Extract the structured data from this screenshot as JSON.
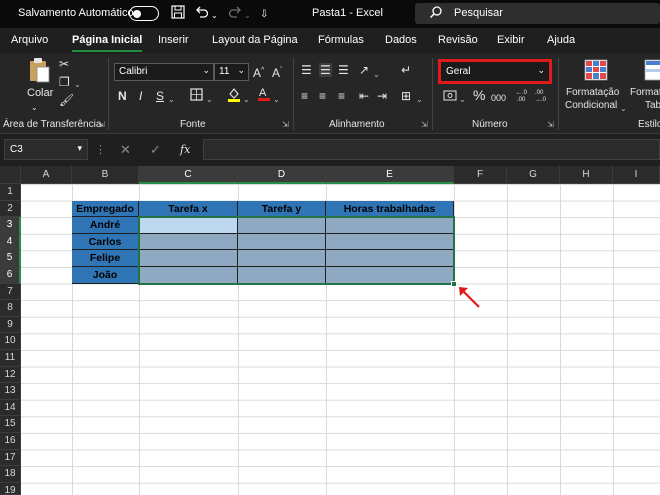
{
  "titlebar": {
    "autosave_label": "Salvamento Automático",
    "doc_title": "Pasta1  -  Excel",
    "search_placeholder": "Pesquisar"
  },
  "tabs": [
    {
      "label": "Arquivo"
    },
    {
      "label": "Página Inicial",
      "active": true
    },
    {
      "label": "Inserir"
    },
    {
      "label": "Layout da Página"
    },
    {
      "label": "Fórmulas"
    },
    {
      "label": "Dados"
    },
    {
      "label": "Revisão"
    },
    {
      "label": "Exibir"
    },
    {
      "label": "Ajuda"
    }
  ],
  "ribbon": {
    "clipboard": {
      "paste_label": "Colar",
      "group_label": "Área de Transferência"
    },
    "font": {
      "family": "Calibri",
      "size": "11",
      "bold": "N",
      "italic": "I",
      "underline": "S",
      "group_label": "Fonte"
    },
    "alignment": {
      "group_label": "Alinhamento"
    },
    "number": {
      "format": "Geral",
      "percent": "%",
      "thousands": "000",
      "group_label": "Número"
    },
    "styles": {
      "cond_format_line1": "Formatação",
      "cond_format_line2": "Condicional",
      "table_format_line1": "Formata",
      "table_format_line2": "Tab",
      "group_label": "Estilo"
    }
  },
  "formula_bar": {
    "name_box": "C3",
    "fx": "fx",
    "value": ""
  },
  "grid": {
    "columns": [
      "A",
      "B",
      "C",
      "D",
      "E",
      "F",
      "G",
      "H",
      "I"
    ],
    "rows": [
      "1",
      "2",
      "3",
      "4",
      "5",
      "6",
      "7",
      "8",
      "9",
      "10",
      "11",
      "12",
      "13",
      "14",
      "15",
      "16",
      "17",
      "18",
      "19"
    ],
    "table_headers": [
      "Empregado",
      "Tarefa x",
      "Tarefa y",
      "Horas trabalhadas"
    ],
    "employees": [
      "André",
      "Carlos",
      "Felipe",
      "João"
    ]
  },
  "colors": {
    "accent": "#217346",
    "header_blue": "#2f75b5",
    "highlight_red": "#e01b1b"
  }
}
